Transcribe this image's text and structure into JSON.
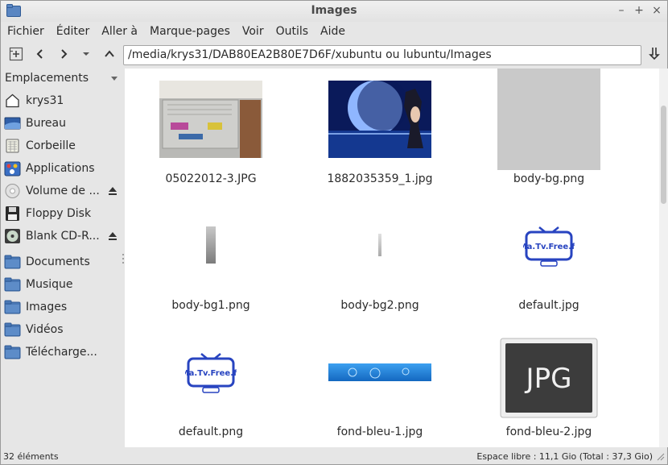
{
  "window": {
    "title": "Images"
  },
  "menubar": {
    "items": [
      "Fichier",
      "Éditer",
      "Aller à",
      "Marque-pages",
      "Voir",
      "Outils",
      "Aide"
    ]
  },
  "toolbar": {
    "path": "/media/krys31/DAB80EA2B80E7D6F/xubuntu ou lubuntu/Images"
  },
  "sidebar": {
    "header": "Emplacements",
    "places": [
      {
        "label": "krys31",
        "icon": "home-icon"
      },
      {
        "label": "Bureau",
        "icon": "desktop-icon"
      },
      {
        "label": "Corbeille",
        "icon": "trash-icon"
      },
      {
        "label": "Applications",
        "icon": "applications-icon"
      },
      {
        "label": "Volume de ...",
        "icon": "drive-icon"
      },
      {
        "label": "Floppy Disk",
        "icon": "floppy-icon"
      },
      {
        "label": "Blank CD-R...",
        "icon": "cd-icon"
      }
    ],
    "bookmarks": [
      {
        "label": "Documents",
        "icon": "folder-icon"
      },
      {
        "label": "Musique",
        "icon": "folder-icon"
      },
      {
        "label": "Images",
        "icon": "folder-icon"
      },
      {
        "label": "Vidéos",
        "icon": "folder-icon"
      },
      {
        "label": "Télécharge...",
        "icon": "folder-icon"
      }
    ]
  },
  "files": [
    {
      "name": "05022012-3.JPG",
      "thumb": "computer-back-photo"
    },
    {
      "name": "1882035359_1.jpg",
      "thumb": "moon-girl-photo"
    },
    {
      "name": "body-bg.png",
      "thumb": "gray-texture"
    },
    {
      "name": "body-bg1.png",
      "thumb": "gray-bar"
    },
    {
      "name": "body-bg2.png",
      "thumb": "small-gray-bar"
    },
    {
      "name": "default.jpg",
      "thumb": "matvfree-logo"
    },
    {
      "name": "default.png",
      "thumb": "matvfree-logo"
    },
    {
      "name": "fond-bleu-1.jpg",
      "thumb": "blue-banner"
    },
    {
      "name": "fond-bleu-2.jpg",
      "thumb": "jpg-file-icon"
    }
  ],
  "logo_text": "Ma.Tv.Free.fr",
  "jpg_icon_text": "JPG",
  "status": {
    "count": "32 éléments",
    "free_space": "Espace libre : 11,1 Gio (Total : 37,3 Gio)"
  },
  "colors": {
    "folder": "#4a78b5",
    "logo_blue": "#2844c0",
    "banner": "#1a7bd0"
  }
}
